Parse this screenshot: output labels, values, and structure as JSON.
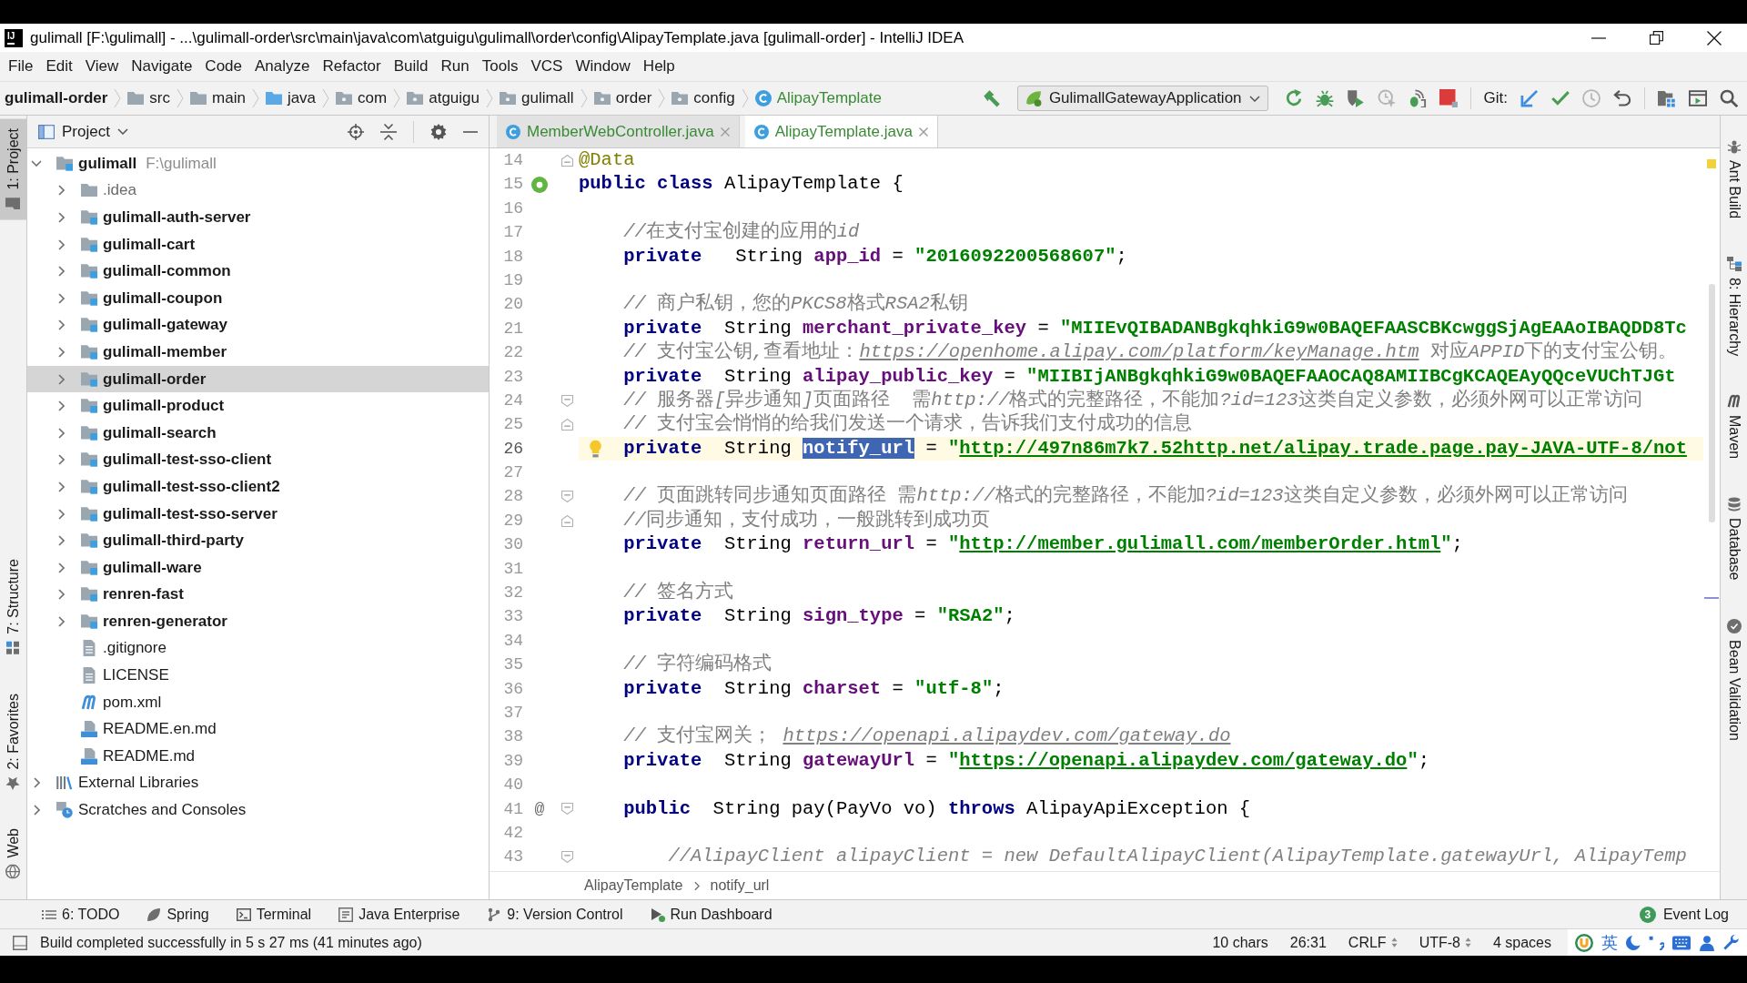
{
  "window": {
    "logo": "IJ",
    "title": "gulimall [F:\\gulimall] - ...\\gulimall-order\\src\\main\\java\\com\\atguigu\\gulimall\\order\\config\\AlipayTemplate.java [gulimall-order] - IntelliJ IDEA"
  },
  "menu": [
    "File",
    "Edit",
    "View",
    "Navigate",
    "Code",
    "Analyze",
    "Refactor",
    "Build",
    "Run",
    "Tools",
    "VCS",
    "Window",
    "Help"
  ],
  "navigation_bar": {
    "crumbs": [
      {
        "kind": "module",
        "label": "gulimall-order"
      },
      {
        "kind": "folder",
        "label": "src"
      },
      {
        "kind": "folder",
        "label": "main"
      },
      {
        "kind": "source_folder",
        "label": "java"
      },
      {
        "kind": "package",
        "label": "com"
      },
      {
        "kind": "package",
        "label": "atguigu"
      },
      {
        "kind": "package",
        "label": "gulimall"
      },
      {
        "kind": "package",
        "label": "order"
      },
      {
        "kind": "package",
        "label": "config"
      },
      {
        "kind": "class",
        "label": "AlipayTemplate"
      }
    ]
  },
  "toolbar": {
    "run_configuration": "GulimallGatewayApplication",
    "vcs_label": "Git:"
  },
  "left_stripe": {
    "top": [
      {
        "kind": "project",
        "label": "1: Project",
        "selected": true
      }
    ],
    "bottom": [
      {
        "kind": "structure",
        "label": "7: Structure",
        "selected": false
      },
      {
        "kind": "favorites",
        "label": "2: Favorites",
        "selected": false
      },
      {
        "kind": "web",
        "label": "Web",
        "selected": false
      }
    ]
  },
  "project_panel": {
    "title": "Project",
    "tree": [
      {
        "kind": "module",
        "label": "gulimall",
        "path": "F:\\gulimall",
        "expanded": true,
        "selected": false,
        "children": [
          {
            "kind": "folder",
            "label": ".idea",
            "expanded": false,
            "selected": false
          },
          {
            "kind": "module",
            "label": "gulimall-auth-server",
            "expanded": false,
            "selected": false
          },
          {
            "kind": "module",
            "label": "gulimall-cart",
            "expanded": false,
            "selected": false
          },
          {
            "kind": "module",
            "label": "gulimall-common",
            "expanded": false,
            "selected": false
          },
          {
            "kind": "module",
            "label": "gulimall-coupon",
            "expanded": false,
            "selected": false
          },
          {
            "kind": "module",
            "label": "gulimall-gateway",
            "expanded": false,
            "selected": false
          },
          {
            "kind": "module",
            "label": "gulimall-member",
            "expanded": false,
            "selected": false
          },
          {
            "kind": "module",
            "label": "gulimall-order",
            "expanded": false,
            "selected": true
          },
          {
            "kind": "module",
            "label": "gulimall-product",
            "expanded": false,
            "selected": false
          },
          {
            "kind": "module",
            "label": "gulimall-search",
            "expanded": false,
            "selected": false
          },
          {
            "kind": "module",
            "label": "gulimall-test-sso-client",
            "expanded": false,
            "selected": false
          },
          {
            "kind": "module",
            "label": "gulimall-test-sso-client2",
            "expanded": false,
            "selected": false
          },
          {
            "kind": "module",
            "label": "gulimall-test-sso-server",
            "expanded": false,
            "selected": false
          },
          {
            "kind": "module",
            "label": "gulimall-third-party",
            "expanded": false,
            "selected": false
          },
          {
            "kind": "module",
            "label": "gulimall-ware",
            "expanded": false,
            "selected": false
          },
          {
            "kind": "module",
            "label": "renren-fast",
            "expanded": false,
            "selected": false
          },
          {
            "kind": "module",
            "label": "renren-generator",
            "expanded": false,
            "selected": false
          },
          {
            "kind": "text_file",
            "label": ".gitignore",
            "selected": false
          },
          {
            "kind": "text_file",
            "label": "LICENSE",
            "selected": false
          },
          {
            "kind": "maven",
            "label": "pom.xml",
            "selected": false
          },
          {
            "kind": "markdown",
            "label": "README.en.md",
            "selected": false
          },
          {
            "kind": "markdown",
            "label": "README.md",
            "selected": false
          }
        ]
      },
      {
        "kind": "libraries",
        "label": "External Libraries",
        "expanded": false,
        "selected": false
      },
      {
        "kind": "scratches",
        "label": "Scratches and Consoles",
        "expanded": false,
        "selected": false
      }
    ]
  },
  "editor": {
    "tabs": [
      {
        "kind": "class",
        "label": "MemberWebController.java",
        "selected": false
      },
      {
        "kind": "class",
        "label": "AlipayTemplate.java",
        "selected": true
      }
    ],
    "lines": [
      {
        "number": "14",
        "kind": "top",
        "current": false,
        "fold": {
          "kind": "end"
        },
        "tokens": [
          {
            "kind": "annotation",
            "text": "@Data"
          }
        ]
      },
      {
        "number": "15",
        "kind": "top",
        "current": false,
        "marker": {
          "kind": "bean"
        },
        "tokens": [
          {
            "kind": "keyword",
            "text": "public class"
          },
          {
            "kind": "plain",
            "text": " AlipayTemplate {"
          }
        ]
      },
      {
        "number": "16",
        "kind": "blank",
        "current": false
      },
      {
        "number": "17",
        "kind": "member",
        "current": false,
        "tokens": [
          {
            "kind": "comment",
            "text": "//在支付宝创建的应用的id"
          }
        ]
      },
      {
        "number": "18",
        "kind": "member",
        "current": false,
        "tokens": [
          {
            "kind": "keyword",
            "text": "private"
          },
          {
            "kind": "plain",
            "text": "   String "
          },
          {
            "kind": "field",
            "text": "app_id"
          },
          {
            "kind": "plain",
            "text": " = "
          },
          {
            "kind": "string",
            "text": "\"2016092200568607\""
          },
          {
            "kind": "plain",
            "text": ";"
          }
        ]
      },
      {
        "number": "19",
        "kind": "blank",
        "current": false
      },
      {
        "number": "20",
        "kind": "member",
        "current": false,
        "tokens": [
          {
            "kind": "comment",
            "text": "// 商户私钥，您的PKCS8格式RSA2私钥"
          }
        ]
      },
      {
        "number": "21",
        "kind": "member",
        "current": false,
        "tokens": [
          {
            "kind": "keyword",
            "text": "private"
          },
          {
            "kind": "plain",
            "text": "  String "
          },
          {
            "kind": "field",
            "text": "merchant_private_key"
          },
          {
            "kind": "plain",
            "text": " = "
          },
          {
            "kind": "string",
            "text": "\"MIIEvQIBADANBgkqhkiG9w0BAQEFAASCBKcwggSjAgEAAoIBAQDD8Tc"
          }
        ]
      },
      {
        "number": "22",
        "kind": "member",
        "current": false,
        "tokens": [
          {
            "kind": "comment",
            "text": "// 支付宝公钥,查看地址："
          },
          {
            "kind": "comment_link",
            "text": "https://openhome.alipay.com/platform/keyManage.htm"
          },
          {
            "kind": "comment",
            "text": " 对应APPID下的支付宝公钥。"
          }
        ]
      },
      {
        "number": "23",
        "kind": "member",
        "current": false,
        "tokens": [
          {
            "kind": "keyword",
            "text": "private"
          },
          {
            "kind": "plain",
            "text": "  String "
          },
          {
            "kind": "field",
            "text": "alipay_public_key"
          },
          {
            "kind": "plain",
            "text": " = "
          },
          {
            "kind": "string",
            "text": "\"MIIBIjANBgkqhkiG9w0BAQEFAAOCAQ8AMIIBCgKCAQEAyQQceVUChTJGt"
          }
        ]
      },
      {
        "number": "24",
        "kind": "member",
        "current": false,
        "fold": {
          "kind": "start"
        },
        "tokens": [
          {
            "kind": "comment",
            "text": "// 服务器[异步通知]页面路径  需http://格式的完整路径，不能加?id=123这类自定义参数，必须外网可以正常访问"
          }
        ]
      },
      {
        "number": "25",
        "kind": "member",
        "current": false,
        "fold": {
          "kind": "end"
        },
        "tokens": [
          {
            "kind": "comment",
            "text": "// 支付宝会悄悄的给我们发送一个请求，告诉我们支付成功的信息"
          }
        ]
      },
      {
        "number": "26",
        "kind": "member",
        "current": true,
        "marker": {
          "kind": "bulb"
        },
        "tokens": [
          {
            "kind": "keyword",
            "text": "private"
          },
          {
            "kind": "plain",
            "text": "  String "
          },
          {
            "kind": "selected_text",
            "text": "notify_url"
          },
          {
            "kind": "plain",
            "text": " = "
          },
          {
            "kind": "string",
            "text": "\""
          },
          {
            "kind": "string_link",
            "text": "http://497n86m7k7.52http.net/alipay.trade.page.pay-JAVA-UTF-8/not"
          }
        ]
      },
      {
        "number": "27",
        "kind": "blank",
        "current": false
      },
      {
        "number": "28",
        "kind": "member",
        "current": false,
        "fold": {
          "kind": "start"
        },
        "tokens": [
          {
            "kind": "comment",
            "text": "// 页面跳转同步通知页面路径 需http://格式的完整路径，不能加?id=123这类自定义参数，必须外网可以正常访问"
          }
        ]
      },
      {
        "number": "29",
        "kind": "member",
        "current": false,
        "fold": {
          "kind": "end"
        },
        "tokens": [
          {
            "kind": "comment",
            "text": "//同步通知，支付成功，一般跳转到成功页"
          }
        ]
      },
      {
        "number": "30",
        "kind": "member",
        "current": false,
        "tokens": [
          {
            "kind": "keyword",
            "text": "private"
          },
          {
            "kind": "plain",
            "text": "  String "
          },
          {
            "kind": "field",
            "text": "return_url"
          },
          {
            "kind": "plain",
            "text": " = "
          },
          {
            "kind": "string",
            "text": "\""
          },
          {
            "kind": "string_link",
            "text": "http://member.gulimall.com/memberOrder.html"
          },
          {
            "kind": "string",
            "text": "\""
          },
          {
            "kind": "plain",
            "text": ";"
          }
        ]
      },
      {
        "number": "31",
        "kind": "blank",
        "current": false
      },
      {
        "number": "32",
        "kind": "member",
        "current": false,
        "tokens": [
          {
            "kind": "comment",
            "text": "// 签名方式"
          }
        ]
      },
      {
        "number": "33",
        "kind": "member",
        "current": false,
        "tokens": [
          {
            "kind": "keyword",
            "text": "private"
          },
          {
            "kind": "plain",
            "text": "  String "
          },
          {
            "kind": "field",
            "text": "sign_type"
          },
          {
            "kind": "plain",
            "text": " = "
          },
          {
            "kind": "string",
            "text": "\"RSA2\""
          },
          {
            "kind": "plain",
            "text": ";"
          }
        ]
      },
      {
        "number": "34",
        "kind": "blank",
        "current": false
      },
      {
        "number": "35",
        "kind": "member",
        "current": false,
        "tokens": [
          {
            "kind": "comment",
            "text": "// 字符编码格式"
          }
        ]
      },
      {
        "number": "36",
        "kind": "member",
        "current": false,
        "tokens": [
          {
            "kind": "keyword",
            "text": "private"
          },
          {
            "kind": "plain",
            "text": "  String "
          },
          {
            "kind": "field",
            "text": "charset"
          },
          {
            "kind": "plain",
            "text": " = "
          },
          {
            "kind": "string",
            "text": "\"utf-8\""
          },
          {
            "kind": "plain",
            "text": ";"
          }
        ]
      },
      {
        "number": "37",
        "kind": "blank",
        "current": false
      },
      {
        "number": "38",
        "kind": "member",
        "current": false,
        "tokens": [
          {
            "kind": "comment",
            "text": "// 支付宝网关； "
          },
          {
            "kind": "comment_link",
            "text": "https://openapi.alipaydev.com/gateway.do"
          }
        ]
      },
      {
        "number": "39",
        "kind": "member",
        "current": false,
        "tokens": [
          {
            "kind": "keyword",
            "text": "private"
          },
          {
            "kind": "plain",
            "text": "  String "
          },
          {
            "kind": "field",
            "text": "gatewayUrl"
          },
          {
            "kind": "plain",
            "text": " = "
          },
          {
            "kind": "string",
            "text": "\""
          },
          {
            "kind": "string_link",
            "text": "https://openapi.alipaydev.com/gateway.do"
          },
          {
            "kind": "string",
            "text": "\""
          },
          {
            "kind": "plain",
            "text": ";"
          }
        ]
      },
      {
        "number": "40",
        "kind": "blank",
        "current": false
      },
      {
        "number": "41",
        "kind": "member",
        "current": false,
        "marker_text": "@",
        "fold": {
          "kind": "start"
        },
        "tokens": [
          {
            "kind": "keyword",
            "text": "public"
          },
          {
            "kind": "plain",
            "text": "  String pay(PayVo vo) "
          },
          {
            "kind": "keyword",
            "text": "throws"
          },
          {
            "kind": "plain",
            "text": " AlipayApiException {"
          }
        ]
      },
      {
        "number": "42",
        "kind": "blank",
        "current": false
      },
      {
        "number": "43",
        "kind": "nested",
        "current": false,
        "fold": {
          "kind": "start"
        },
        "tokens": [
          {
            "kind": "comment",
            "text": "//AlipayClient alipayClient = new DefaultAlipayClient(AlipayTemplate.gatewayUrl, AlipayTemp"
          }
        ]
      }
    ],
    "breadcrumbs": [
      "AlipayTemplate",
      "notify_url"
    ]
  },
  "right_stripe": [
    {
      "kind": "ant",
      "label": "Ant Build",
      "selected": false
    },
    {
      "kind": "hierarchy",
      "label": "8: Hierarchy",
      "selected": false
    },
    {
      "kind": "maven",
      "label": "Maven",
      "selected": false
    },
    {
      "kind": "database",
      "label": "Database",
      "selected": false
    },
    {
      "kind": "bean_validation",
      "label": "Bean Validation",
      "selected": false
    }
  ],
  "tool_window_bar": {
    "left": [
      {
        "kind": "todo",
        "label": "6: TODO",
        "selected": false
      },
      {
        "kind": "spring",
        "label": "Spring",
        "selected": false
      },
      {
        "kind": "terminal",
        "label": "Terminal",
        "selected": false
      },
      {
        "kind": "java_enterprise",
        "label": "Java Enterprise",
        "selected": false
      },
      {
        "kind": "vcs",
        "label": "9: Version Control",
        "selected": false
      },
      {
        "kind": "run_dashboard",
        "label": "Run Dashboard",
        "selected": false
      }
    ],
    "right": [
      {
        "kind": "event_log",
        "label": "Event Log",
        "badge": "3",
        "selected": false
      }
    ]
  },
  "status_bar": {
    "message": "Build completed successfully in 5 s 27 ms (41 minutes ago)",
    "widgets": [
      {
        "kind": "text",
        "text": "10 chars"
      },
      {
        "kind": "text",
        "text": "26:31"
      },
      {
        "kind": "dropdown",
        "text": "CRLF"
      },
      {
        "kind": "dropdown",
        "text": "UTF-8"
      },
      {
        "kind": "text",
        "text": "4 spaces"
      }
    ],
    "input_method": "英"
  }
}
